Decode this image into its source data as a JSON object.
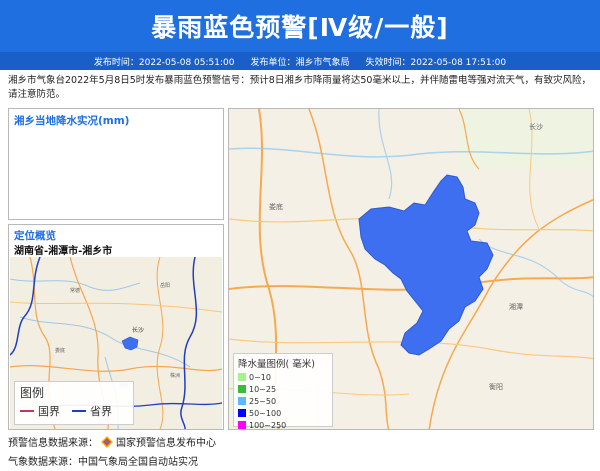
{
  "header": {
    "title": "暴雨蓝色预警[Ⅳ级/一般]",
    "publish_time": "发布时间：2022-05-08 05:51:00",
    "publisher": "发布单位：湘乡市气象局",
    "expire_time": "失效时间：2022-05-08 17:51:00"
  },
  "description": "湘乡市气象台2022年5月8日5时发布暴雨蓝色预警信号：预计8日湘乡市降雨量将达50毫米以上，并伴随雷电等强对流天气，有致灾风险，请注意防范。",
  "rain_panel": {
    "title": "湘乡当地降水实况(mm)"
  },
  "location_panel": {
    "title": "定位概览",
    "path": "湖南省-湘潭市-湘乡市",
    "legend_title": "图例",
    "legend_items": [
      {
        "label": "国界",
        "color": "#c0395a"
      },
      {
        "label": "省界",
        "color": "#1f3fbf"
      }
    ]
  },
  "rain_legend": {
    "title": "降水量图例( 毫米)",
    "items": [
      {
        "label": "0~10",
        "color": "#a6f28f"
      },
      {
        "label": "10~25",
        "color": "#3dba3d"
      },
      {
        "label": "25~50",
        "color": "#61b8ff"
      },
      {
        "label": "50~100",
        "color": "#0000fe"
      },
      {
        "label": "100~250",
        "color": "#fa00fa"
      }
    ]
  },
  "warning_area_color": "#3d6ff0",
  "footer": {
    "warning_source": "预警信息数据来源：",
    "warning_source_name": "国家预警信息发布中心",
    "weather_source": "气象数据来源：中国气象局全国自动站实况"
  }
}
